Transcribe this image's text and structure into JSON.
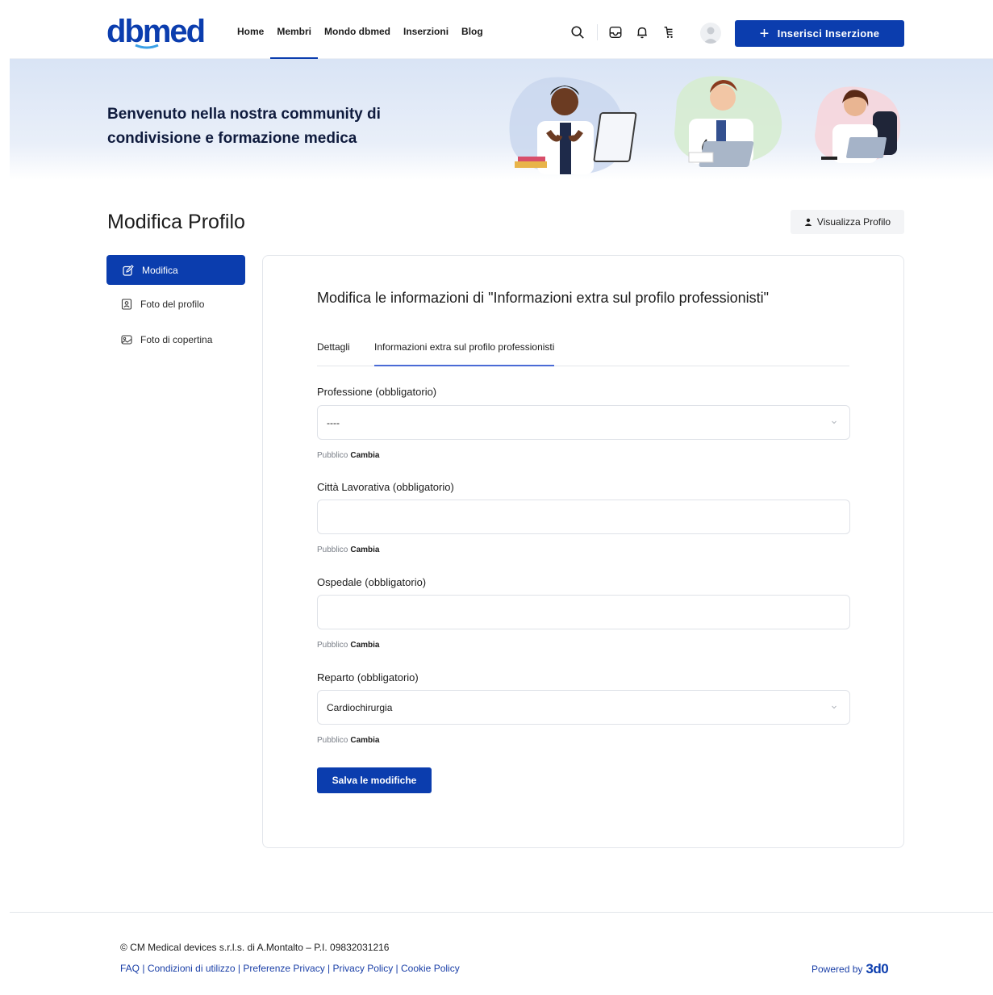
{
  "header": {
    "logo_text": "dbmed",
    "nav": [
      "Home",
      "Membri",
      "Mondo dbmed",
      "Inserzioni",
      "Blog"
    ],
    "active_nav": "Membri",
    "cta_label": "Inserisci Inserzione",
    "icons": [
      "search-icon",
      "inbox-icon",
      "bell-icon",
      "cart-icon",
      "user-avatar"
    ]
  },
  "hero": {
    "headline": "Benvenuto nella nostra community di condivisione e formazione medica"
  },
  "page": {
    "title": "Modifica Profilo",
    "view_profile_label": "Visualizza Profilo"
  },
  "sidebar": {
    "items": [
      {
        "label": "Modifica",
        "icon": "edit-icon",
        "active": true
      },
      {
        "label": "Foto del profilo",
        "icon": "profile-photo-icon",
        "active": false
      },
      {
        "label": "Foto di copertina",
        "icon": "cover-photo-icon",
        "active": false
      }
    ]
  },
  "form": {
    "title": "Modifica le informazioni di \"Informazioni extra sul profilo professionisti\"",
    "tabs": [
      {
        "label": "Dettagli",
        "active": false
      },
      {
        "label": "Informazioni extra sul profilo professionisti",
        "active": true
      }
    ],
    "fields": [
      {
        "label": "Professione (obbligatorio)",
        "type": "select",
        "value": "----",
        "visibility": "Pubblico",
        "change_label": "Cambia"
      },
      {
        "label": "Città Lavorativa (obbligatorio)",
        "type": "text",
        "value": "",
        "visibility": "Pubblico",
        "change_label": "Cambia"
      },
      {
        "label": "Ospedale (obbligatorio)",
        "type": "text",
        "value": "",
        "visibility": "Pubblico",
        "change_label": "Cambia"
      },
      {
        "label": "Reparto (obbligatorio)",
        "type": "select",
        "value": "Cardiochirurgia",
        "visibility": "Pubblico",
        "change_label": "Cambia"
      }
    ],
    "save_label": "Salva le modifiche"
  },
  "footer": {
    "copyright": "© CM Medical devices s.r.l.s. di A.Montalto – P.I. 09832031216",
    "links": [
      "FAQ",
      "Condizioni di utilizzo",
      "Preferenze Privacy",
      "Privacy Policy",
      "Cookie Policy"
    ],
    "powered_by": "Powered by",
    "powered_brand": "3d0"
  },
  "colors": {
    "primary": "#0b3dae",
    "hero_bg": "#d9e4f5",
    "link": "#1a3fa7"
  }
}
